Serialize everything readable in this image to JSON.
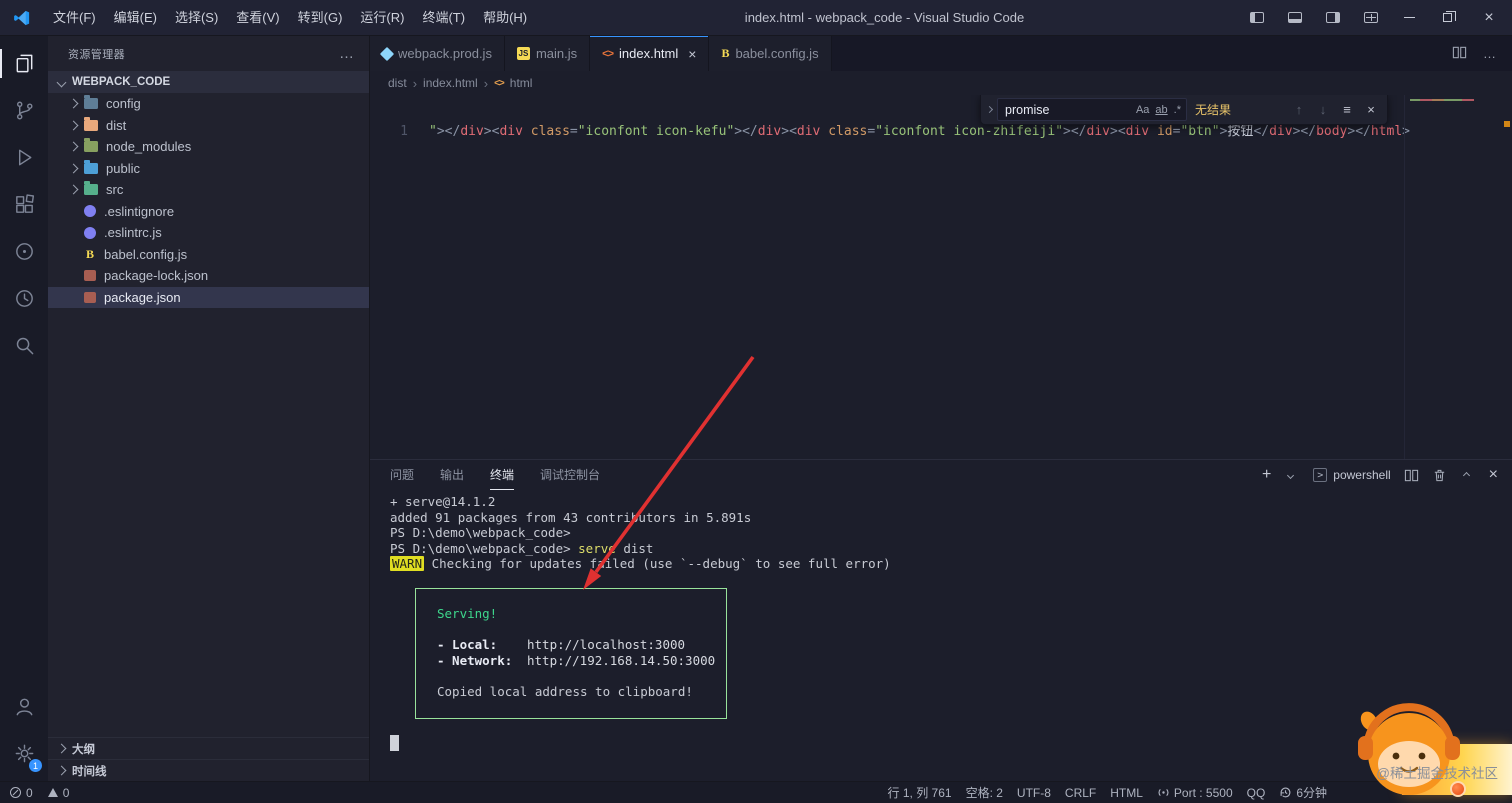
{
  "colors": {
    "accent": "#3794ff",
    "serving_green": "#3dd68c",
    "warn_yellow": "#e0de22",
    "find_no_results": "#e9c46a",
    "syntax_tag": "#e06c75",
    "syntax_attr": "#d19a66",
    "syntax_string": "#98c379",
    "arrow_red": "#e03131",
    "selection_row": "#33364d"
  },
  "title_bar": {
    "title": "index.html - webpack_code - Visual Studio Code",
    "menus": [
      {
        "name": "file",
        "label": "文件(F)"
      },
      {
        "name": "edit",
        "label": "编辑(E)"
      },
      {
        "name": "selection",
        "label": "选择(S)"
      },
      {
        "name": "view",
        "label": "查看(V)"
      },
      {
        "name": "goto",
        "label": "转到(G)"
      },
      {
        "name": "run",
        "label": "运行(R)"
      },
      {
        "name": "terminal",
        "label": "终端(T)"
      },
      {
        "name": "help",
        "label": "帮助(H)"
      }
    ]
  },
  "activity": {
    "badge": "1"
  },
  "sidebar": {
    "header": "资源管理器",
    "root": "WEBPACK_CODE",
    "items": [
      {
        "name": "config",
        "label": "config",
        "kind": "folder",
        "color": "#5f7e97"
      },
      {
        "name": "dist",
        "label": "dist",
        "kind": "folder",
        "color": "#e8a87c"
      },
      {
        "name": "node-modules",
        "label": "node_modules",
        "kind": "folder",
        "color": "#87a060"
      },
      {
        "name": "public",
        "label": "public",
        "kind": "folder",
        "color": "#4d9fd6"
      },
      {
        "name": "src",
        "label": "src",
        "kind": "folder",
        "color": "#56b08c"
      },
      {
        "name": "eslintignore",
        "label": ".eslintignore",
        "kind": "file",
        "icon": "eslint",
        "color": "#8080f2"
      },
      {
        "name": "eslintrc-js",
        "label": ".eslintrc.js",
        "kind": "file",
        "icon": "eslint",
        "color": "#8080f2"
      },
      {
        "name": "babel-config-js",
        "label": "babel.config.js",
        "kind": "file",
        "icon": "babel",
        "color": "#f5da55"
      },
      {
        "name": "package-lock-json",
        "label": "package-lock.json",
        "kind": "file",
        "icon": "npm",
        "color": "#a85e52"
      },
      {
        "name": "package-json",
        "label": "package.json",
        "kind": "file",
        "icon": "npm",
        "color": "#a85e52",
        "selected": true
      }
    ],
    "sections": [
      {
        "name": "outline",
        "label": "大纲"
      },
      {
        "name": "timeline",
        "label": "时间线"
      }
    ]
  },
  "tabs": [
    {
      "name": "webpack-prod-js",
      "label": "webpack.prod.js",
      "icon": "webpack",
      "active": false
    },
    {
      "name": "main-js",
      "label": "main.js",
      "icon": "js",
      "active": false
    },
    {
      "name": "index-html",
      "label": "index.html",
      "icon": "html",
      "active": true
    },
    {
      "name": "babel-config-js",
      "label": "babel.config.js",
      "icon": "babel",
      "active": false
    }
  ],
  "breadcrumb": [
    {
      "name": "dist",
      "label": "dist",
      "icon": false
    },
    {
      "name": "index-html",
      "label": "index.html",
      "icon": false
    },
    {
      "name": "html",
      "label": "html",
      "icon": true
    }
  ],
  "find": {
    "query": "promise",
    "results": "无结果"
  },
  "editor": {
    "line_number": "1",
    "tokens": [
      [
        "s",
        "\""
      ],
      [
        "p",
        ">"
      ],
      [
        "p",
        "</"
      ],
      [
        "t",
        "div"
      ],
      [
        "p",
        ">"
      ],
      [
        "p",
        "<"
      ],
      [
        "t",
        "div"
      ],
      [
        "d",
        " "
      ],
      [
        "a",
        "class"
      ],
      [
        "p",
        "="
      ],
      [
        "s",
        "\"iconfont icon-kefu\""
      ],
      [
        "p",
        ">"
      ],
      [
        "p",
        "</"
      ],
      [
        "t",
        "div"
      ],
      [
        "p",
        ">"
      ],
      [
        "p",
        "<"
      ],
      [
        "t",
        "div"
      ],
      [
        "d",
        " "
      ],
      [
        "a",
        "class"
      ],
      [
        "p",
        "="
      ],
      [
        "s",
        "\"iconfont icon-zhifeiji\""
      ],
      [
        "p",
        ">"
      ],
      [
        "p",
        "</"
      ],
      [
        "t",
        "div"
      ],
      [
        "p",
        ">"
      ],
      [
        "p",
        "<"
      ],
      [
        "t",
        "div"
      ],
      [
        "d",
        " "
      ],
      [
        "a",
        "id"
      ],
      [
        "p",
        "="
      ],
      [
        "s",
        "\"btn\""
      ],
      [
        "p",
        ">"
      ],
      [
        "d",
        "按钮"
      ],
      [
        "p",
        "</"
      ],
      [
        "t",
        "div"
      ],
      [
        "p",
        ">"
      ],
      [
        "p",
        "</"
      ],
      [
        "t",
        "body"
      ],
      [
        "p",
        ">"
      ],
      [
        "p",
        "</"
      ],
      [
        "t",
        "html"
      ],
      [
        "p",
        ">"
      ]
    ]
  },
  "panel": {
    "tabs": [
      {
        "name": "problems",
        "label": "问题",
        "active": false
      },
      {
        "name": "output",
        "label": "输出",
        "active": false
      },
      {
        "name": "terminal",
        "label": "终端",
        "active": true
      },
      {
        "name": "debug-console",
        "label": "调试控制台",
        "active": false
      }
    ],
    "shell_label": "powershell"
  },
  "terminal": {
    "lines": [
      [
        [
          "d",
          "+ serve@14.1.2"
        ]
      ],
      [
        [
          "d",
          "added 91 packages from 43 contributors in 5.891s"
        ]
      ],
      [
        [
          "d",
          "PS D:\\demo\\webpack_code>"
        ]
      ],
      [
        [
          "d",
          "PS D:\\demo\\webpack_code> "
        ],
        [
          "y",
          "serve"
        ],
        [
          "d",
          " dist"
        ]
      ],
      [
        [
          "warn",
          "WARN"
        ],
        [
          "d",
          " Checking for updates failed (use `--debug` to see full error)"
        ]
      ]
    ],
    "serve_box": {
      "title": "Serving!",
      "rows": [
        {
          "label": "- Local:",
          "url": "http://localhost:3000"
        },
        {
          "label": "- Network:",
          "url": "http://192.168.14.50:3000"
        }
      ],
      "footer": "Copied local address to clipboard!"
    }
  },
  "status_bar": {
    "errors": "0",
    "warnings": "0",
    "right_items": [
      {
        "name": "cursor-position",
        "label": "行 1, 列 761"
      },
      {
        "name": "indentation",
        "label": "空格: 2"
      },
      {
        "name": "encoding",
        "label": "UTF-8"
      },
      {
        "name": "eol",
        "label": "CRLF"
      },
      {
        "name": "language-mode",
        "label": "HTML"
      },
      {
        "name": "live-server-port",
        "label": "Port : 5500",
        "icon": "broadcast"
      },
      {
        "name": "qq",
        "label": "QQ"
      },
      {
        "name": "timer",
        "label": "6分钟",
        "icon": "history"
      }
    ]
  },
  "watermark": {
    "text": "@稀土掘金技术社区"
  }
}
